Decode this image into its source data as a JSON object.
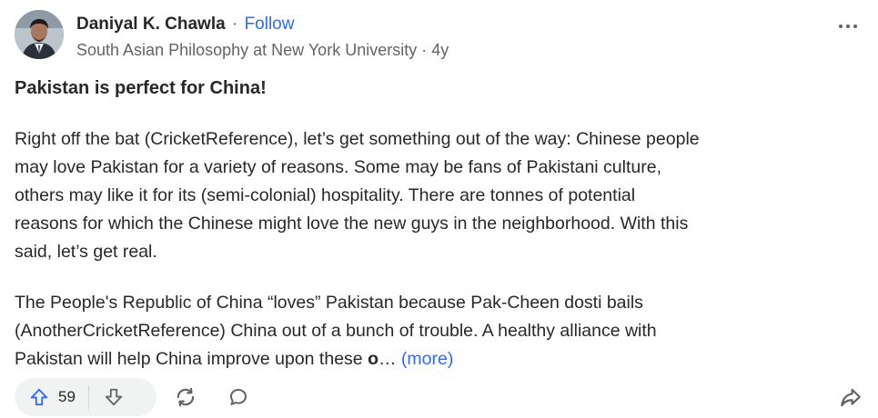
{
  "author": {
    "name": "Daniyal K. Chawla",
    "separator": "·",
    "follow_label": "Follow",
    "credential": "South Asian Philosophy at New York University · 4y"
  },
  "post": {
    "title": "Pakistan is perfect for China!",
    "paragraph1_lines": [
      "Right off the bat (CricketReference), let’s get something out of the way: Chinese people",
      "may love Pakistan for a variety of reasons. Some may be fans of Pakistani culture,",
      "others may like it for its (semi-colonial) hospitality. There are tonnes of potential",
      "reasons for which the Chinese might love the new guys in the neighborhood. With this",
      "said, let’s get real."
    ],
    "paragraph2_lines": [
      "The People's Republic of China “loves” Pakistan because Pak-Cheen dosti bails",
      "(AnotherCricketReference) China out of a bunch of trouble. A healthy alliance with"
    ],
    "paragraph2_last_line_text": "Pakistan will help China improve upon these ",
    "paragraph2_last_bold": "o",
    "ellipsis": "…",
    "more_label": "(more)"
  },
  "actions": {
    "upvote_count": "59"
  },
  "icons": {
    "upvote": "upvote-arrow-icon",
    "downvote": "downvote-arrow-icon",
    "share_reshare": "reshare-icon",
    "comment": "comment-bubble-icon",
    "share": "share-arrow-icon",
    "more": "more-dots-icon"
  },
  "colors": {
    "accent": "#2e69ff",
    "text": "#282829",
    "muted": "#636466",
    "pill_bg": "#f1f2f2"
  }
}
